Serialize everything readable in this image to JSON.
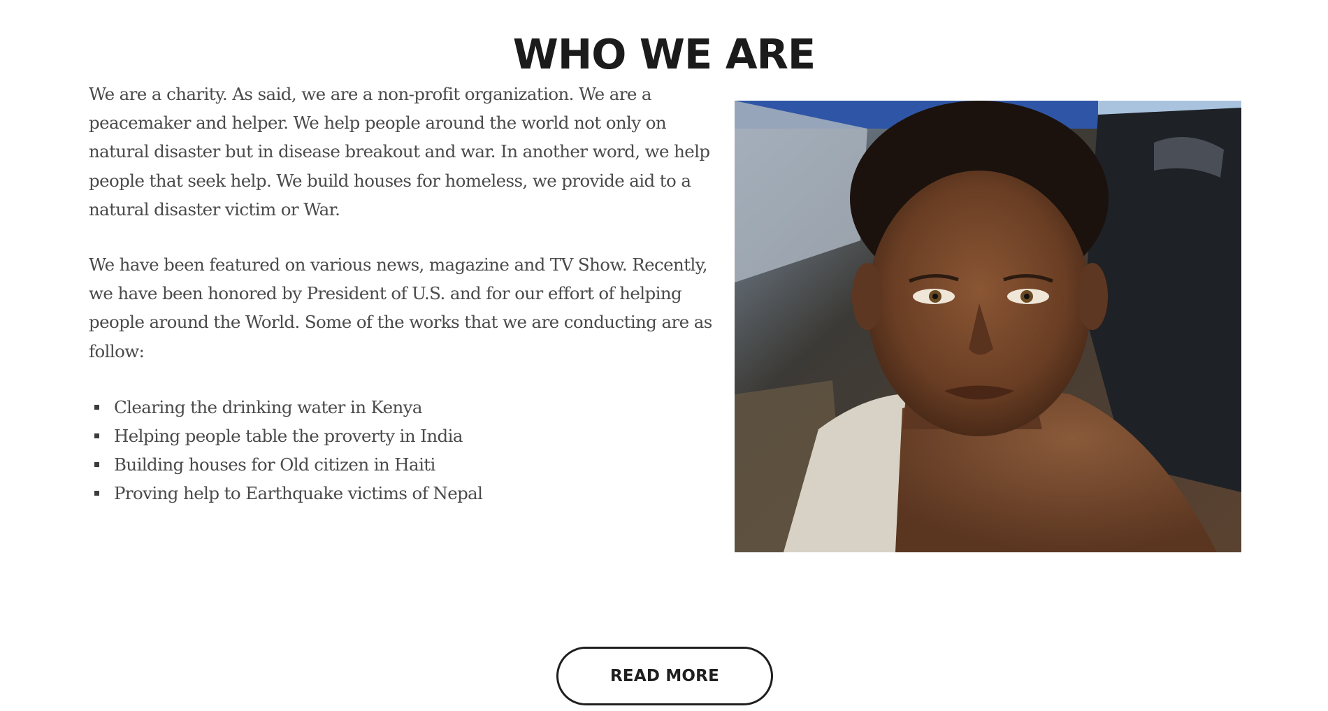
{
  "section": {
    "title": "WHO WE ARE"
  },
  "intro": {
    "paragraph_1": "We are a charity. As said, we are a non-profit organization. We are a peacemaker and helper. We help people around the world not only on natural disaster but in disease breakout and war.  In another word, we help people that seek help. We build houses for homeless, we provide aid to a natural disaster victim or War.",
    "paragraph_2": "We have been featured on various news, magazine and TV Show. Recently, we have been honored by President of U.S. and for our effort of helping people around the World. Some of the works that we are conducting are as follow:"
  },
  "works": [
    "Clearing the drinking water in Kenya",
    "Helping people table the proverty in India",
    "Building houses for Old citizen in Haiti",
    "Proving help to Earthquake victims of Nepal"
  ],
  "actions": {
    "read_more_label": "READ MORE"
  },
  "colors": {
    "heading": "#1b1b1b",
    "body_text": "#4a4a4a",
    "button_border": "#1f1f1f",
    "background": "#ffffff"
  }
}
